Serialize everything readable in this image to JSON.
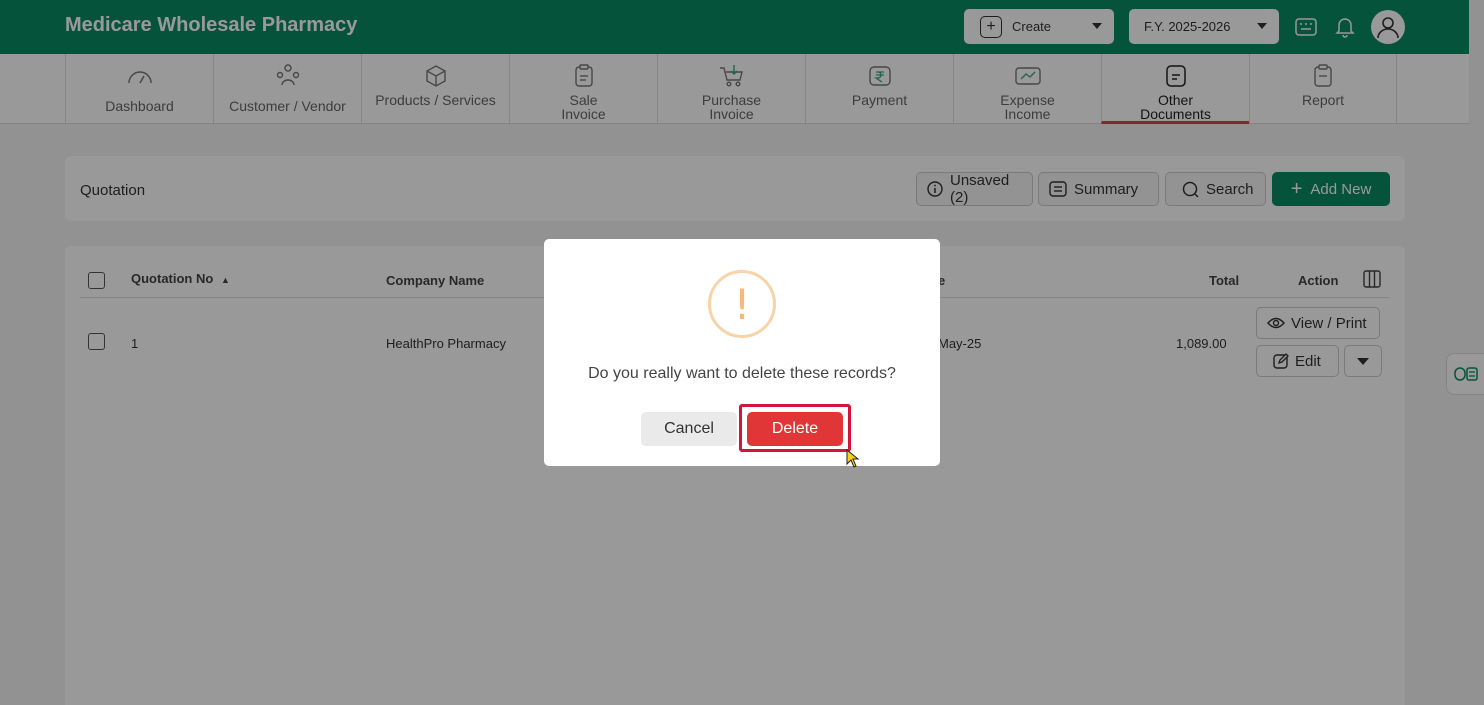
{
  "app": {
    "title": "Medicare Wholesale Pharmacy",
    "create_label": "Create",
    "fy_label": "F.Y. 2025-2026"
  },
  "nav": {
    "items": [
      {
        "label": "Dashboard",
        "icon": "gauge-icon"
      },
      {
        "label": "Customer / Vendor",
        "icon": "users-icon"
      },
      {
        "label": "Products / Services",
        "icon": "box-icon"
      },
      {
        "label": "Sale Invoice",
        "icon": "invoice-icon"
      },
      {
        "label": "Purchase Invoice",
        "icon": "cart-icon"
      },
      {
        "label": "Payment",
        "icon": "rupee-icon"
      },
      {
        "label": "Expense Income",
        "icon": "money-icon"
      },
      {
        "label": "Other Documents",
        "icon": "document-icon",
        "active": true
      },
      {
        "label": "Report",
        "icon": "clipboard-icon"
      }
    ]
  },
  "page": {
    "title": "Quotation",
    "unsaved_label": "Unsaved (2)",
    "summary_label": "Summary",
    "search_label": "Search",
    "add_new_label": "Add New"
  },
  "table": {
    "headers": {
      "quotation_no": "Quotation No",
      "company_name": "Company Name",
      "date_partial": "e",
      "total": "Total",
      "action": "Action"
    },
    "rows": [
      {
        "quotation_no": "1",
        "company_name": "HealthPro Pharmacy",
        "date_partial": "May-25",
        "total": "1,089.00"
      }
    ],
    "view_print_label": "View / Print",
    "edit_label": "Edit"
  },
  "dialog": {
    "icon": "!",
    "message": "Do you really want to delete these records?",
    "cancel_label": "Cancel",
    "delete_label": "Delete"
  },
  "colors": {
    "brand": "#0b8a63",
    "danger": "#e13637",
    "highlight": "#d4143a",
    "warning": "#f5b97a"
  }
}
